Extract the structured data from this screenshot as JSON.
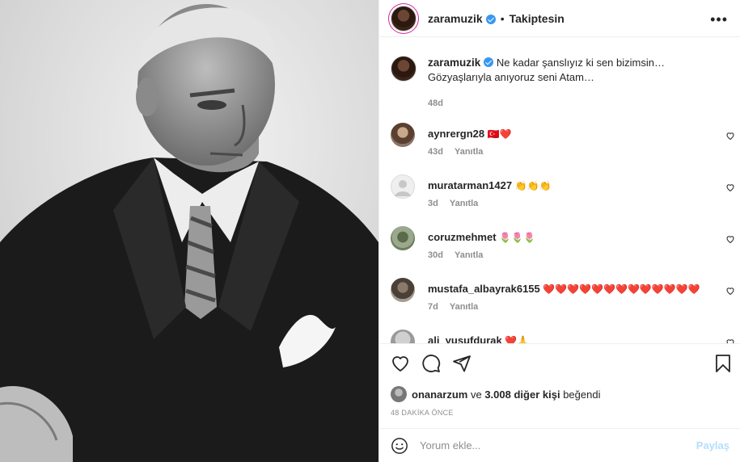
{
  "post": {
    "author": "zaramuzik",
    "follow_status": "Takiptesin",
    "caption_username": "zaramuzik",
    "caption_text": "Ne kadar şanslıyız ki sen bizimsin… Gözyaşlarıyla anıyoruz seni Atam…",
    "caption_time": "48d"
  },
  "comments": [
    {
      "username": "aynrergn28",
      "text": "🇹🇷❤️",
      "time": "43d",
      "reply": "Yanıtla"
    },
    {
      "username": "muratarman1427",
      "text": "👏👏👏",
      "time": "3d",
      "reply": "Yanıtla"
    },
    {
      "username": "coruzmehmet",
      "text": "🌷🌷🌷",
      "time": "30d",
      "reply": "Yanıtla"
    },
    {
      "username": "mustafa_albayrak6155",
      "text": "❤️❤️❤️❤️❤️❤️❤️❤️❤️❤️❤️❤️❤️",
      "time": "7d",
      "reply": "Yanıtla"
    },
    {
      "username": "ali_yusufdurak",
      "text": "❤️🙏",
      "time": "",
      "reply": ""
    }
  ],
  "likes": {
    "liker": "onanarzum",
    "connector": "ve",
    "others": "3.008 diğer kişi",
    "suffix": "beğendi"
  },
  "posted_ago": "48 DAKİKA ÖNCE",
  "comment_box": {
    "placeholder": "Yorum ekle...",
    "post_label": "Paylaş"
  },
  "icons": {
    "more": "more-options-icon",
    "like": "heart-icon",
    "comment": "comment-bubble-icon",
    "share": "paper-plane-icon",
    "save": "bookmark-icon",
    "emoji": "emoji-smile-icon"
  },
  "colors": {
    "verified": "#3897f0",
    "muted": "#8e8e8e",
    "post_button_disabled": "#b2dffc",
    "border": "#efefef"
  }
}
